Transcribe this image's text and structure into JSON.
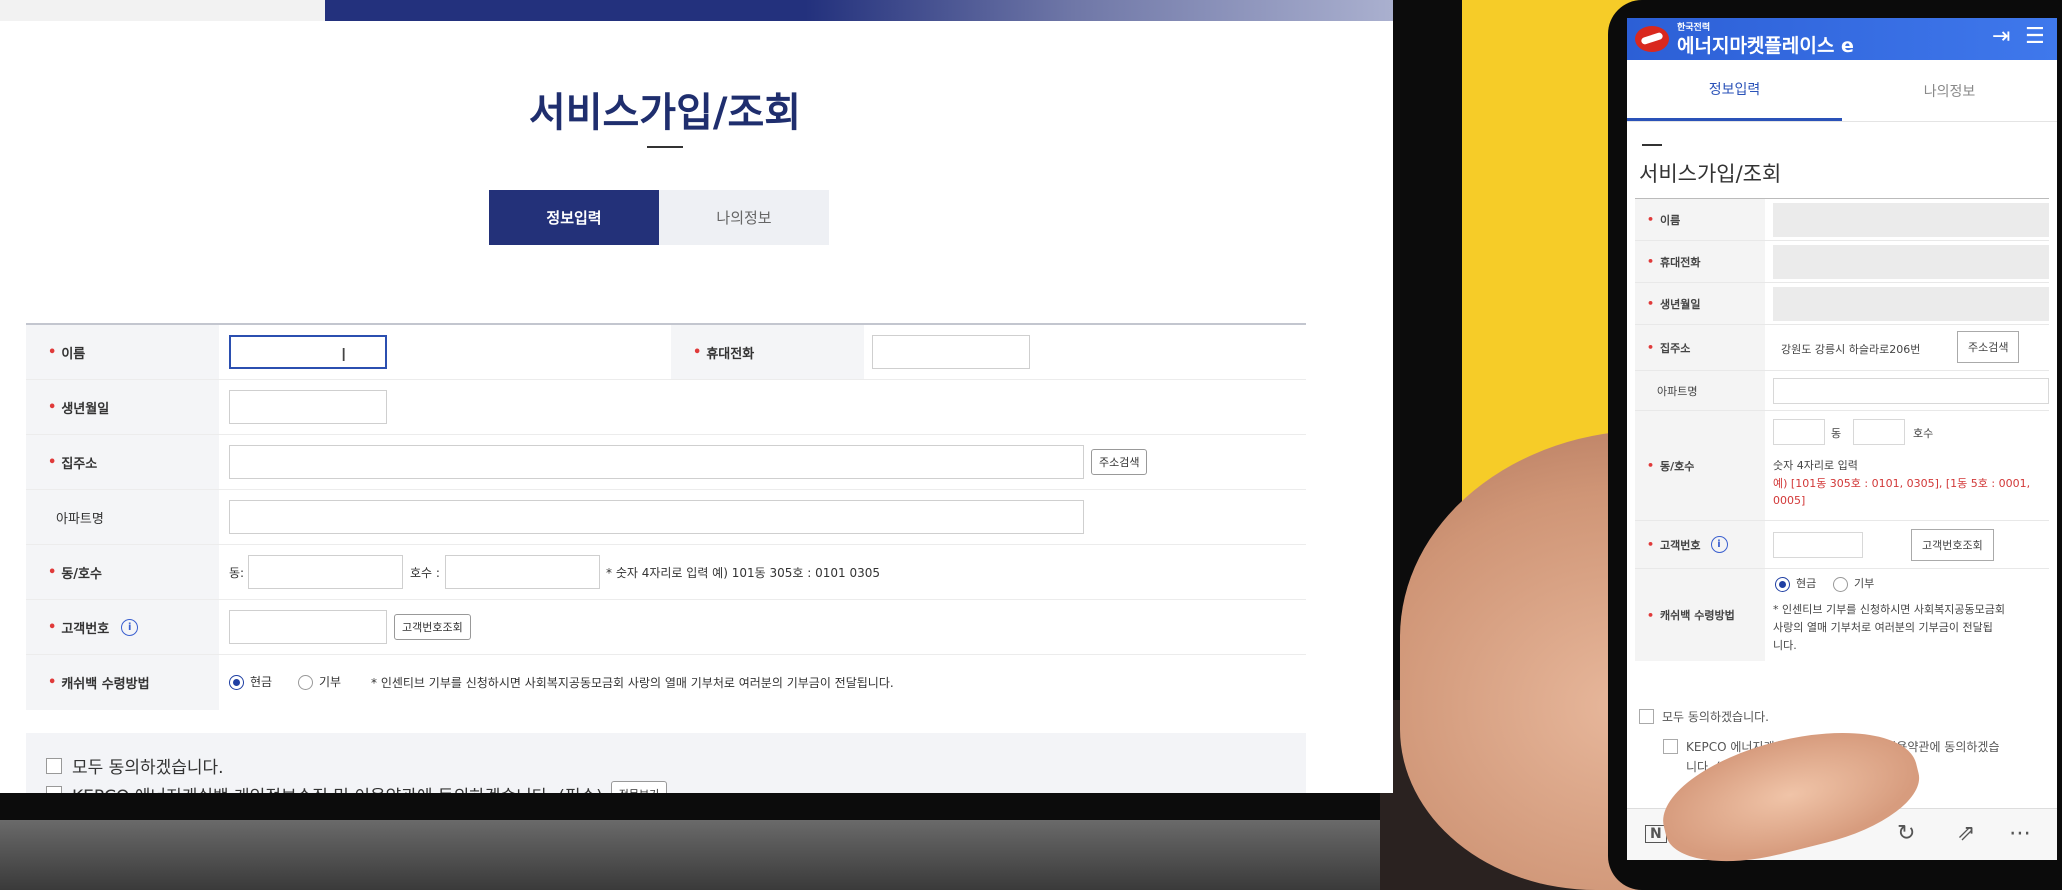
{
  "desktop": {
    "page_title": "서비스가입/조회",
    "tabs": [
      {
        "label": "정보입력",
        "active": true
      },
      {
        "label": "나의정보",
        "active": false
      }
    ],
    "form": {
      "name_label": "이름",
      "phone_label": "휴대전화",
      "birth_label": "생년월일",
      "address_label": "집주소",
      "address_button": "주소검색",
      "apartment_label": "아파트명",
      "dong_ho_label": "동/호수",
      "dong_prefix": "동:",
      "ho_prefix": "호수 :",
      "dong_ho_hint": "* 숫자 4자리로 입력 예) 101동 305호 : 0101 0305",
      "customer_label": "고객번호",
      "customer_button": "고객번호조회",
      "cashback_label": "캐쉬백 수령방법",
      "option_cash": "현금",
      "option_donate": "기부",
      "cashback_hint": "* 인센티브 기부를 신청하시면 사회복지공동모금회 사랑의 열매 기부처로 여러분의 기부금이 전달됩니다."
    },
    "agree": {
      "all": "모두 동의하겠습니다.",
      "kepco": "KEPCO 에너지캐쉬백 개인정보수집 및 이용약관에 동의하겠습니다. (필수)",
      "view_button": "전문보기"
    }
  },
  "phone": {
    "brand_small": "한국전력",
    "brand": "에너지마켓플레이스",
    "brand_mark": "e",
    "login_icon": "⇥",
    "menu_icon": "☰",
    "tabs": [
      {
        "label": "정보입력",
        "active": true
      },
      {
        "label": "나의정보",
        "active": false
      }
    ],
    "page_title": "서비스가입/조회",
    "form": {
      "name_label": "이름",
      "phone_label": "휴대전화",
      "birth_label": "생년월일",
      "address_label": "집주소",
      "address_value": "강원도 강릉시 하슬라로206번",
      "address_button": "주소검색",
      "apartment_label": "아파트명",
      "dong_suffix": "동",
      "ho_suffix": "호수",
      "dong_ho_label": "동/호수",
      "dong_ho_hint": "숫자 4자리로 입력",
      "dong_ho_example_1": "예) [101동 305호 : 0101, 0305], [1동 5호 : 0001,",
      "dong_ho_example_2": "0005]",
      "customer_label": "고객번호",
      "customer_button": "고객번호조회",
      "cashback_label": "캐쉬백 수령방법",
      "option_cash": "현금",
      "option_donate": "기부",
      "cashback_hint_1": "* 인센티브 기부를 신청하시면 사회복지공동모금회",
      "cashback_hint_2": "사랑의 열매 기부처로 여러분의 기부금이 전달됩",
      "cashback_hint_3": "니다."
    },
    "agree": {
      "all": "모두 동의하겠습니다.",
      "kepco_1": "KEPCO 에너지캐쉬백 개인정보수집 및 이용약관에 동의하겠습",
      "kepco_2": "니다. (필"
    }
  }
}
